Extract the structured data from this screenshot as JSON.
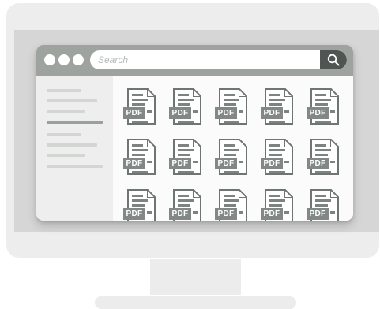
{
  "search": {
    "placeholder": "Search"
  },
  "files": [
    {
      "badge": "PDF"
    },
    {
      "badge": "PDF"
    },
    {
      "badge": "PDF"
    },
    {
      "badge": "PDF"
    },
    {
      "badge": "PDF"
    },
    {
      "badge": "PDF"
    },
    {
      "badge": "PDF"
    },
    {
      "badge": "PDF"
    },
    {
      "badge": "PDF"
    },
    {
      "badge": "PDF"
    },
    {
      "badge": "PDF"
    },
    {
      "badge": "PDF"
    },
    {
      "badge": "PDF"
    },
    {
      "badge": "PDF"
    },
    {
      "badge": "PDF"
    }
  ],
  "icons": {
    "search": "magnifier-icon",
    "file": "pdf-file-icon"
  },
  "colors": {
    "titlebar": "#9ea3a0",
    "search_button": "#4f5553",
    "sidebar": "#eeeeee",
    "sidebar_active": "#9aa09d",
    "pdf_badge": "#828885"
  }
}
